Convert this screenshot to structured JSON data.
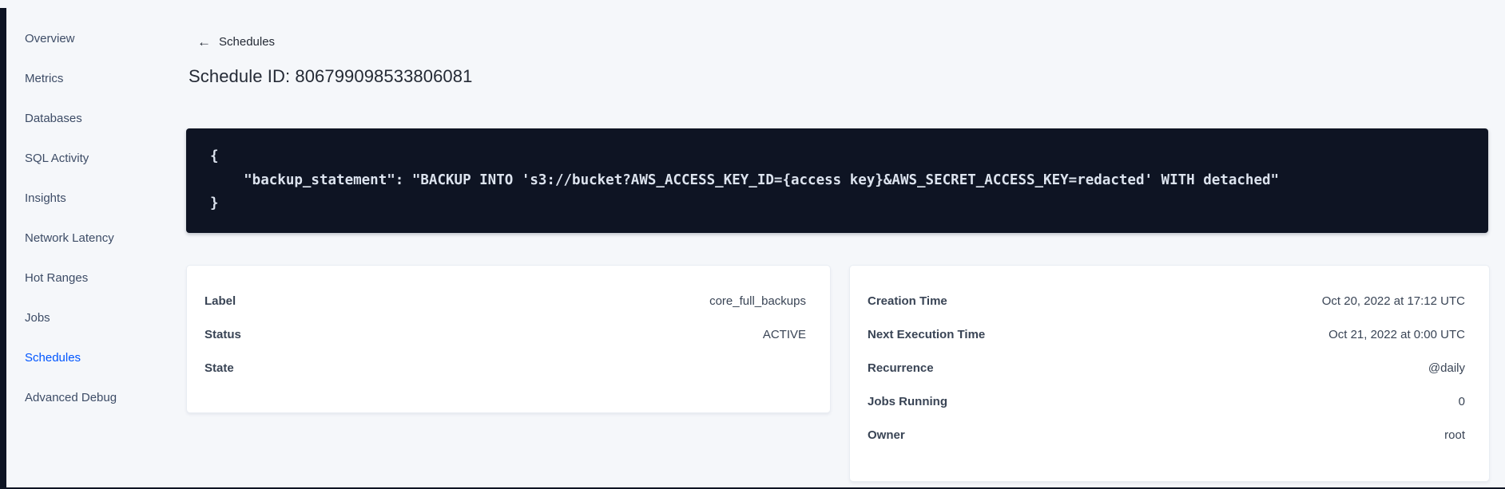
{
  "colors": {
    "page_bg": "#f5f7fa",
    "chrome_dark": "#0e1423",
    "nav_text": "#3d4c66",
    "accent": "#0055ff",
    "heading_text": "#242a35",
    "body_text": "#394455",
    "code_bg": "#0e1423",
    "code_text": "#dce3ee"
  },
  "sidebar": {
    "items": [
      {
        "label": "Overview",
        "active": false
      },
      {
        "label": "Metrics",
        "active": false
      },
      {
        "label": "Databases",
        "active": false
      },
      {
        "label": "SQL Activity",
        "active": false
      },
      {
        "label": "Insights",
        "active": false
      },
      {
        "label": "Network Latency",
        "active": false
      },
      {
        "label": "Hot Ranges",
        "active": false
      },
      {
        "label": "Jobs",
        "active": false
      },
      {
        "label": "Schedules",
        "active": true
      },
      {
        "label": "Advanced Debug",
        "active": false
      }
    ]
  },
  "header": {
    "back_icon_glyph": "←",
    "back_label": "Schedules",
    "title": "Schedule ID: 806799098533806081"
  },
  "code_block": {
    "lines": [
      "{",
      "    \"backup_statement\": \"BACKUP INTO 's3://bucket?AWS_ACCESS_KEY_ID={access key}&AWS_SECRET_ACCESS_KEY=redacted' WITH detached\"",
      "}"
    ]
  },
  "cards": {
    "schedule": {
      "rows": [
        {
          "label": "Label",
          "value": "core_full_backups"
        },
        {
          "label": "Status",
          "value": "ACTIVE"
        },
        {
          "label": "State",
          "value": ""
        }
      ]
    },
    "execution": {
      "rows": [
        {
          "label": "Creation Time",
          "value": "Oct 20, 2022 at 17:12 UTC"
        },
        {
          "label": "Next Execution Time",
          "value": "Oct 21, 2022 at 0:00 UTC"
        },
        {
          "label": "Recurrence",
          "value": "@daily"
        },
        {
          "label": "Jobs Running",
          "value": "0"
        },
        {
          "label": "Owner",
          "value": "root"
        }
      ]
    }
  }
}
